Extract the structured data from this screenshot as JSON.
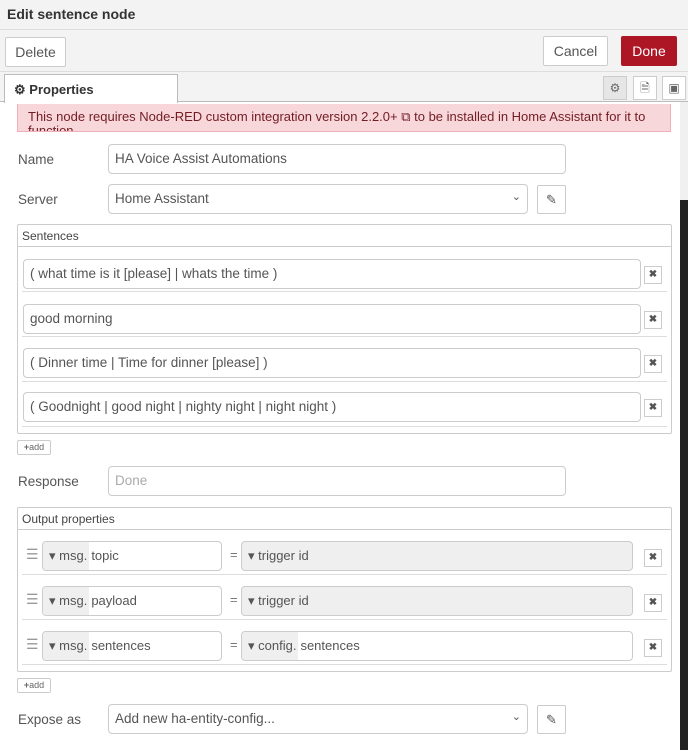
{
  "title": "Edit sentence node",
  "toolbar": {
    "delete": "Delete",
    "cancel": "Cancel",
    "done": "Done"
  },
  "tabs": {
    "properties": "Properties"
  },
  "notice": "This node requires Node-RED custom integration version 2.2.0+ ⧉ to be installed in Home Assistant for it to function.",
  "form": {
    "name_label": "Name",
    "name_value": "HA Voice Assist Automations",
    "server_label": "Server",
    "server_value": "Home Assistant",
    "sentences_label": "Sentences",
    "sentences": [
      "( what time is it [please] | whats the time )",
      "good morning",
      "( Dinner time | Time for dinner [please] )",
      "( Goodnight | good night | nighty night | night night )"
    ],
    "add": "add",
    "response_label": "Response",
    "response_placeholder": "Done",
    "output_label": "Output properties",
    "outputs": [
      {
        "prefix": "msg.",
        "property": "topic",
        "value_prefix": "",
        "value": "trigger id"
      },
      {
        "prefix": "msg.",
        "property": "payload",
        "value_prefix": "",
        "value": "trigger id"
      },
      {
        "prefix": "msg.",
        "property": "sentences",
        "value_prefix": "config.",
        "value": "sentences"
      }
    ],
    "equals": "=",
    "expose_label": "Expose as",
    "expose_value": "Add new ha-entity-config..."
  },
  "colors": {
    "done": "#ad1625",
    "notice_bg": "#f8d7da"
  }
}
